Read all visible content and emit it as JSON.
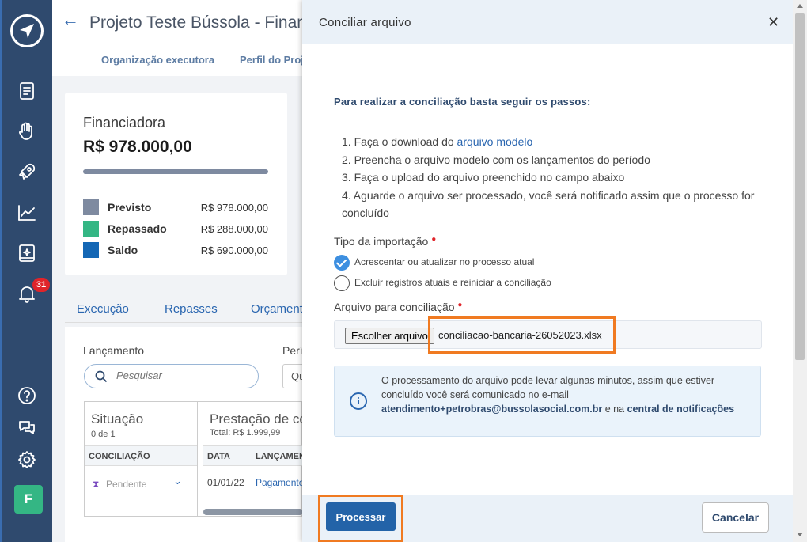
{
  "sidebar": {
    "notification_count": "31",
    "avatar_letter": "F"
  },
  "page": {
    "title": "Projeto Teste Bússola - Financiadora",
    "subnav": [
      "Organização executora",
      "Perfil do Projeto"
    ],
    "card": {
      "title": "Financiadora",
      "amount": "R$ 978.000,00",
      "legend": [
        {
          "label": "Previsto",
          "value": "R$ 978.000,00",
          "color": "#7e8aa0"
        },
        {
          "label": "Repassado",
          "value": "R$ 288.000,00",
          "color": "#34b684"
        },
        {
          "label": "Saldo",
          "value": "R$ 690.000,00",
          "color": "#1467b5"
        }
      ]
    },
    "tabs": [
      "Execução",
      "Repasses",
      "Orçamento"
    ],
    "panel": {
      "lancamento_label": "Lançamento",
      "periodo_label": "Período",
      "search_placeholder": "Pesquisar",
      "select_value": "Qualquer",
      "situacao": {
        "header": "Situação",
        "sub": "0 de 1",
        "col": "CONCILIAÇÃO",
        "status": "Pendente"
      },
      "prestacao": {
        "header": "Prestação de contas",
        "sub": "Total: R$ 1.999,99",
        "col_data": "DATA",
        "col_lanc": "LANÇAMENTO",
        "row_date": "01/01/22",
        "row_lanc": "Pagamento"
      }
    }
  },
  "modal": {
    "title": "Conciliar arquivo",
    "intro": "Para realizar a conciliação basta seguir os passos:",
    "steps": {
      "s1_prefix": "1. Faça o download do ",
      "s1_link": "arquivo modelo",
      "s2": "2. Preencha o arquivo modelo com os lançamentos do período",
      "s3": "3. Faça o upload do arquivo preenchido no campo abaixo",
      "s4": "4. Aguarde o arquivo ser processado, você será notificado assim que o processo for concluído"
    },
    "import_type_label": "Tipo da importação",
    "options": [
      {
        "label": "Acrescentar ou atualizar no processo atual",
        "checked": true
      },
      {
        "label": "Excluir registros atuais e reiniciar a conciliação",
        "checked": false
      }
    ],
    "file_label": "Arquivo para conciliação",
    "file_button": "Escolher arquivo",
    "file_name": "conciliacao-bancaria-26052023.xlsx",
    "info": {
      "text1": "O processamento do arquivo pode levar algunas minutos, assim que estiver concluído você será comunicado no e-mail ",
      "email": "atendimento+petrobras@bussolasocial.com.br",
      "text2": " e na ",
      "notifications": "central de notificações"
    },
    "process_button": "Processar",
    "cancel_button": "Cancelar"
  },
  "colors": {
    "sidebar": "#2f4a6e",
    "primary_button": "#2363a8",
    "highlight": "#f07a21",
    "accent_green": "#34b684"
  }
}
